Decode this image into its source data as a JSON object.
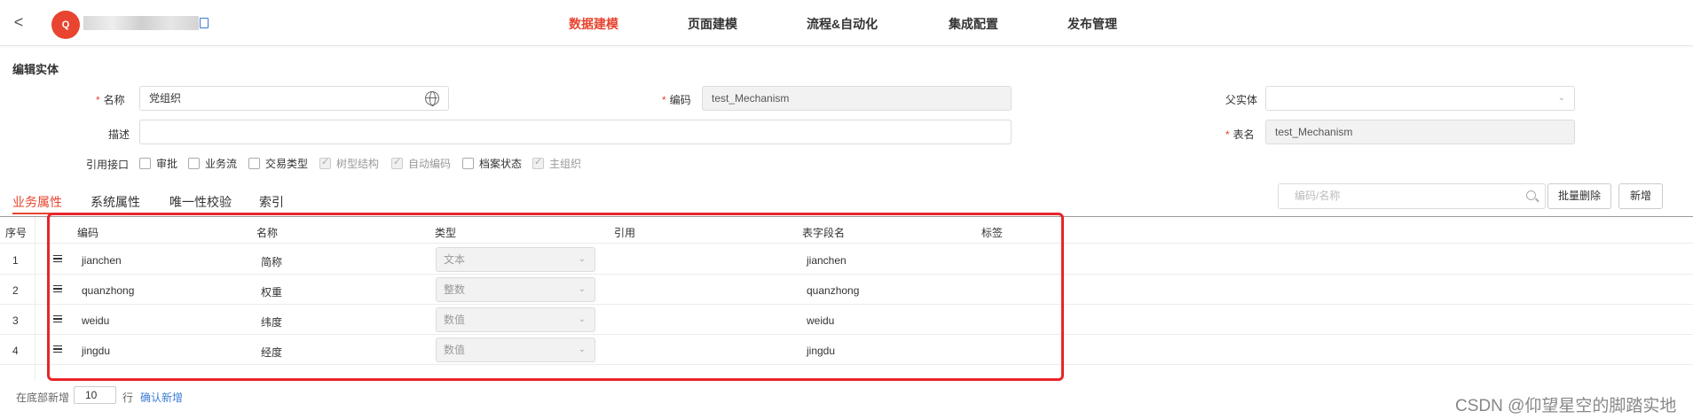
{
  "header": {
    "back": "<",
    "logo_text": "Q",
    "nav": [
      "数据建模",
      "页面建模",
      "流程&自动化",
      "集成配置",
      "发布管理"
    ]
  },
  "form": {
    "title": "编辑实体",
    "name_label": "名称",
    "name_value": "党组织",
    "code_label": "编码",
    "code_value": "test_Mechanism",
    "parent_label": "父实体",
    "parent_value": "",
    "desc_label": "描述",
    "desc_value": "",
    "table_label": "表名",
    "table_value": "test_Mechanism",
    "ref_label": "引用接口",
    "checkboxes": [
      {
        "label": "审批",
        "checked": false
      },
      {
        "label": "业务流",
        "checked": false
      },
      {
        "label": "交易类型",
        "checked": false
      },
      {
        "label": "树型结构",
        "checked": true
      },
      {
        "label": "自动编码",
        "checked": true
      },
      {
        "label": "档案状态",
        "checked": false
      },
      {
        "label": "主组织",
        "checked": true
      }
    ]
  },
  "tabs": [
    "业务属性",
    "系统属性",
    "唯一性校验",
    "索引"
  ],
  "toolbar": {
    "search_placeholder": "编码/名称",
    "batch_delete": "批量删除",
    "add": "新增"
  },
  "table": {
    "headers": [
      "序号",
      "编码",
      "名称",
      "类型",
      "引用",
      "表字段名",
      "标签"
    ],
    "rows": [
      {
        "seq": "1",
        "code": "jianchen",
        "name": "简称",
        "type": "文本",
        "ref": "",
        "column": "jianchen",
        "tag": ""
      },
      {
        "seq": "2",
        "code": "quanzhong",
        "name": "权重",
        "type": "整数",
        "ref": "",
        "column": "quanzhong",
        "tag": ""
      },
      {
        "seq": "3",
        "code": "weidu",
        "name": "纬度",
        "type": "数值",
        "ref": "",
        "column": "weidu",
        "tag": ""
      },
      {
        "seq": "4",
        "code": "jingdu",
        "name": "经度",
        "type": "数值",
        "ref": "",
        "column": "jingdu",
        "tag": ""
      }
    ]
  },
  "footer": {
    "prefix": "在底部新增",
    "count": "10",
    "suffix": "行",
    "confirm": "确认新增"
  },
  "watermark": "CSDN @仰望星空的脚踏实地"
}
